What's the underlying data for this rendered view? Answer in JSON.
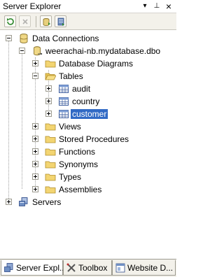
{
  "window": {
    "title": "Server Explorer",
    "pin_glyph": "▾",
    "autohide_glyph": "⊥",
    "close_glyph": "×"
  },
  "toolbar": {
    "buttons": [
      {
        "name": "refresh-button",
        "icon": "refresh-icon"
      },
      {
        "name": "stop-refresh-button",
        "icon": "stop-icon"
      },
      {
        "name": "connect-to-database-button",
        "icon": "connect-database-icon"
      },
      {
        "name": "connect-to-server-button",
        "icon": "connect-server-icon"
      }
    ]
  },
  "tree": {
    "data_connections": "Data Connections",
    "connection": "weerachai-nb.mydatabase.dbo",
    "database_diagrams": "Database Diagrams",
    "tables": "Tables",
    "table_items": [
      "audit",
      "country",
      "customer"
    ],
    "selected_table": "customer",
    "views": "Views",
    "stored_procedures": "Stored Procedures",
    "functions": "Functions",
    "synonyms": "Synonyms",
    "types": "Types",
    "assemblies": "Assemblies",
    "servers": "Servers"
  },
  "tabs": [
    {
      "label": "Server Expl...",
      "icon": "server-explorer-icon",
      "active": true
    },
    {
      "label": "Toolbox",
      "icon": "toolbox-icon",
      "active": false
    },
    {
      "label": "Website D...",
      "icon": "website-icon",
      "active": false
    }
  ],
  "colors": {
    "selection": "#316ac5",
    "folder": "#f0c850",
    "toolbar_bg": "#f3f1ea"
  }
}
